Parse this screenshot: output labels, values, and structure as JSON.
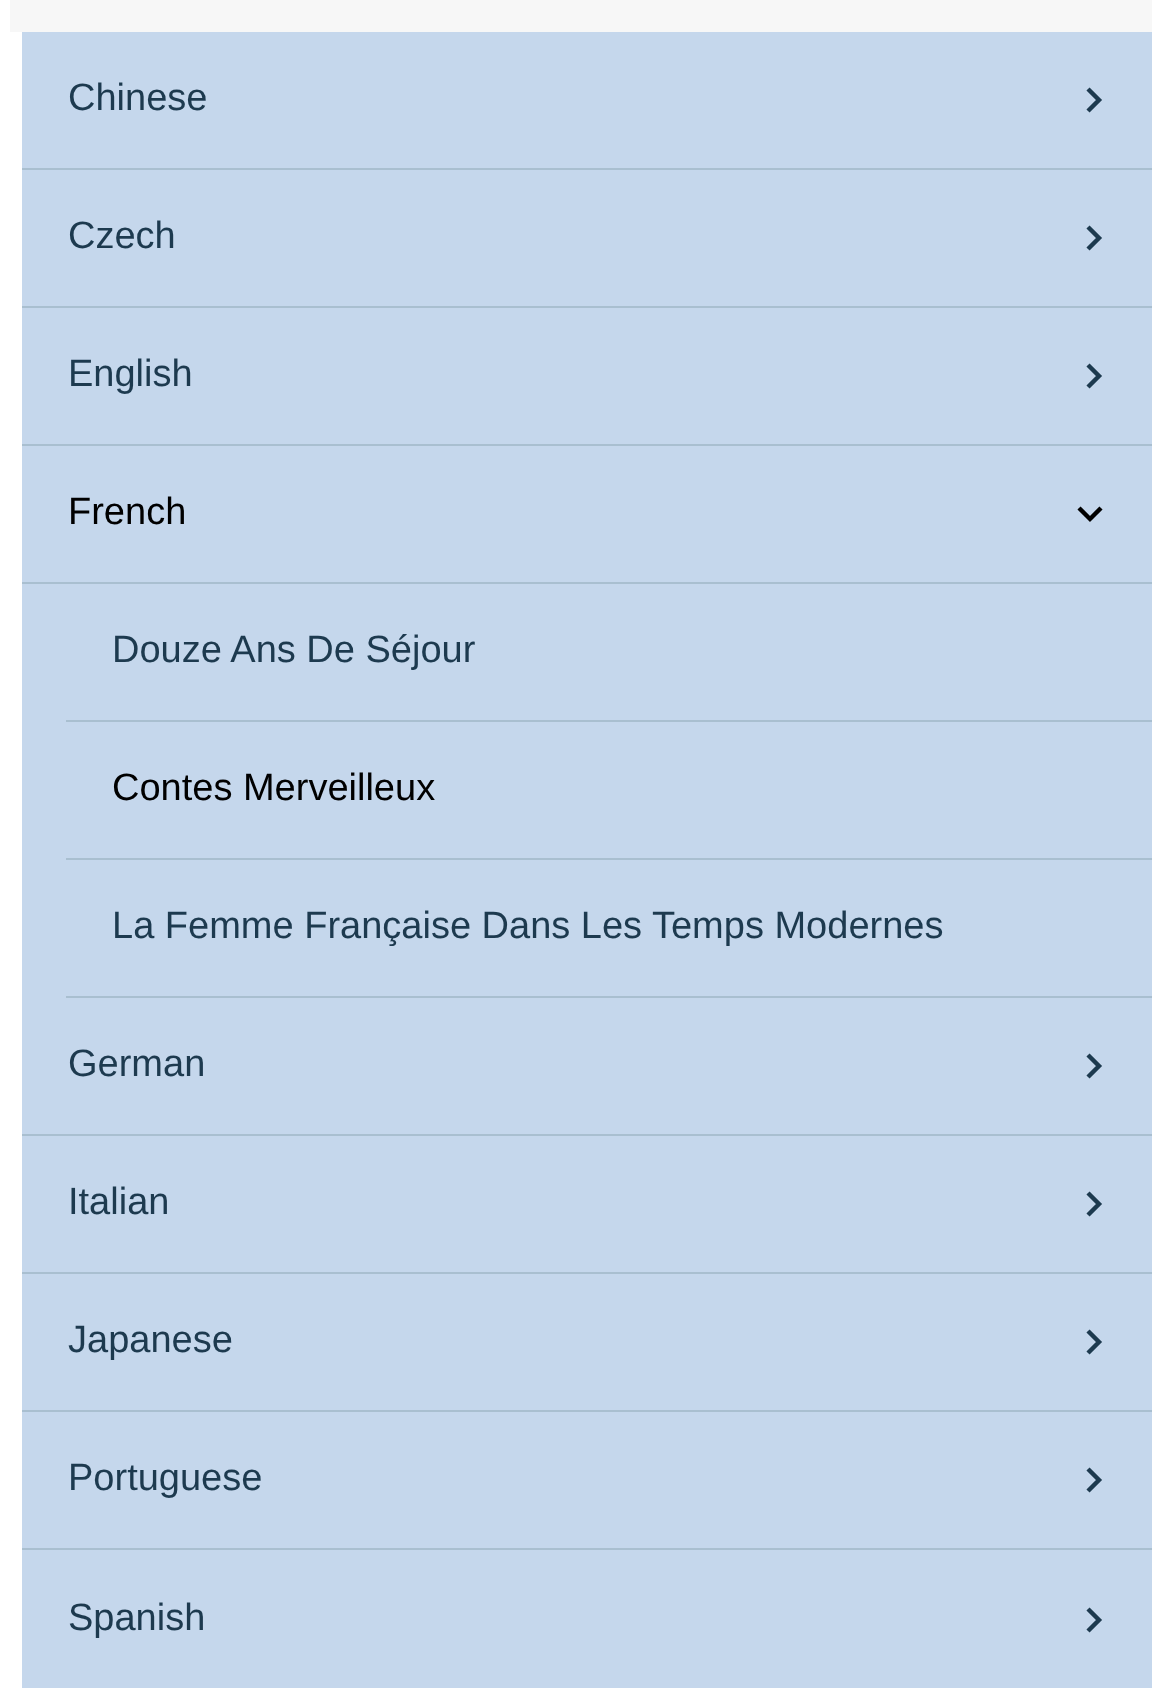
{
  "languages": [
    {
      "label": "Chinese",
      "expanded": false
    },
    {
      "label": "Czech",
      "expanded": false
    },
    {
      "label": "English",
      "expanded": false
    },
    {
      "label": "French",
      "expanded": true,
      "children": [
        {
          "label": "Douze Ans De Séjour",
          "selected": false
        },
        {
          "label": "Contes Merveilleux",
          "selected": true
        },
        {
          "label": "La Femme Française Dans Les Temps Modernes",
          "selected": false
        }
      ]
    },
    {
      "label": "German",
      "expanded": false
    },
    {
      "label": "Italian",
      "expanded": false
    },
    {
      "label": "Japanese",
      "expanded": false
    },
    {
      "label": "Portuguese",
      "expanded": false
    },
    {
      "label": "Spanish",
      "expanded": false
    }
  ]
}
